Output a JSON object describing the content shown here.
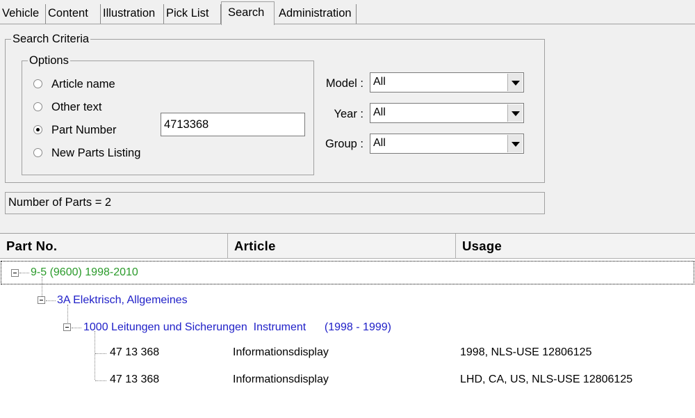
{
  "tabs": [
    "Vehicle",
    "Content",
    "Illustration",
    "Pick List",
    "Search",
    "Administration"
  ],
  "active_tab": "Search",
  "search_criteria": {
    "legend": "Search Criteria",
    "options_legend": "Options",
    "options": [
      {
        "label": "Article name",
        "checked": false
      },
      {
        "label": "Other text",
        "checked": false
      },
      {
        "label": "Part Number",
        "checked": true
      },
      {
        "label": "New Parts Listing",
        "checked": false
      }
    ],
    "part_number_value": "4713368",
    "filters": [
      {
        "label": "Model :",
        "value": "All"
      },
      {
        "label": "Year :",
        "value": "All"
      },
      {
        "label": "Group :",
        "value": "All"
      }
    ]
  },
  "status_text": "Number of Parts = 2",
  "grid": {
    "columns": [
      "Part No.",
      "Article",
      "Usage"
    ],
    "tree": {
      "level1": "9-5 (9600) 1998-2010",
      "level2": "3A Elektrisch, Allgemeines",
      "level3": "1000 Leitungen und Sicherungen  Instrument      (1998 - 1999)"
    },
    "rows": [
      {
        "part_no": "47 13 368",
        "article": "Informationsdisplay",
        "usage": "1998, NLS-USE 12806125"
      },
      {
        "part_no": "47 13 368",
        "article": "Informationsdisplay",
        "usage": "LHD, CA, US, NLS-USE 12806125"
      }
    ]
  },
  "colors": {
    "level1": "#2a9a2a",
    "level2": "#2020c8",
    "level3": "#2020c8"
  }
}
